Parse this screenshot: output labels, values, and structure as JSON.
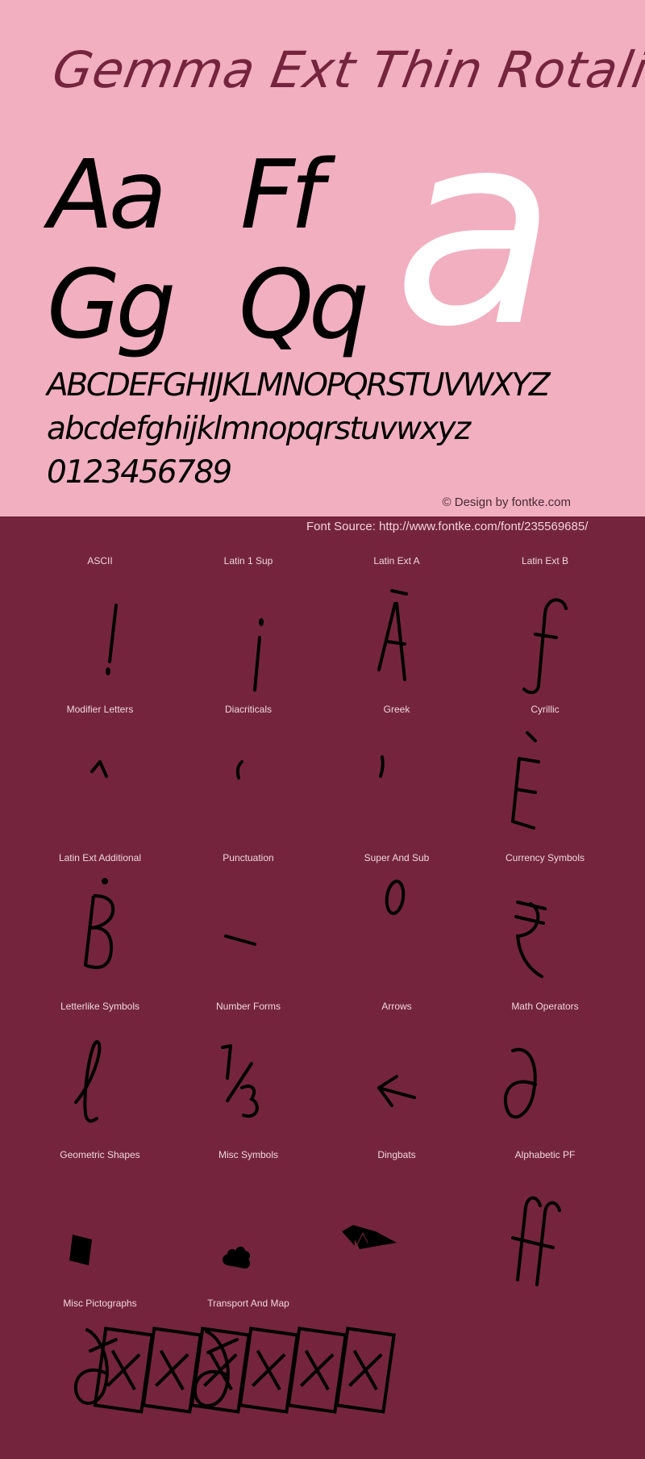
{
  "specimen": {
    "font_name": "Gemma Ext Thin Rotalic",
    "pairs": [
      "Aa",
      "Ff",
      "Gg",
      "Qq"
    ],
    "hero_glyph": "a",
    "uppercase": "ABCDEFGHIJKLMNOPQRSTUVWXYZ",
    "lowercase": "abcdefghijklmnopqrstuvwxyz",
    "digits": "0123456789",
    "credit": "© Design by fontke.com",
    "source": "Font Source: http://www.fontke.com/font/235569685/"
  },
  "colors": {
    "top_background": "#f1afc0",
    "bottom_background": "#74253d",
    "title_color": "#74253d",
    "hero_glyph_color": "#ffffff",
    "glyph_color": "#000000",
    "label_color": "#f0d5dd"
  },
  "blocks": [
    {
      "label": "ASCII",
      "glyph": "!"
    },
    {
      "label": "Latin 1 Sup",
      "glyph": "¡"
    },
    {
      "label": "Latin Ext A",
      "glyph": "Ā"
    },
    {
      "label": "Latin Ext B",
      "glyph": "ƒ"
    },
    {
      "label": "Modifier Letters",
      "glyph": "ˆ"
    },
    {
      "label": "Diacriticals",
      "glyph": "̒"
    },
    {
      "label": "Greek",
      "glyph": "ʹ"
    },
    {
      "label": "Cyrillic",
      "glyph": "Ѐ"
    },
    {
      "label": "Latin Ext Additional",
      "glyph": "Ḃ"
    },
    {
      "label": "Punctuation",
      "glyph": "‒"
    },
    {
      "label": "Super And Sub",
      "glyph": "⁰"
    },
    {
      "label": "Currency Symbols",
      "glyph": "₹"
    },
    {
      "label": "Letterlike Symbols",
      "glyph": "ℓ"
    },
    {
      "label": "Number Forms",
      "glyph": "⅓"
    },
    {
      "label": "Arrows",
      "glyph": "←"
    },
    {
      "label": "Math Operators",
      "glyph": "∂"
    },
    {
      "label": "Geometric Shapes",
      "glyph": "■"
    },
    {
      "label": "Misc Symbols",
      "glyph": "☁"
    },
    {
      "label": "Dingbats",
      "glyph": "✈"
    },
    {
      "label": "Alphabetic PF",
      "glyph": "ﬀ"
    },
    {
      "label": "Misc Pictographs",
      "glyph": "∂̵"
    },
    {
      "label": "Transport And Map",
      "glyph": "▯"
    }
  ]
}
